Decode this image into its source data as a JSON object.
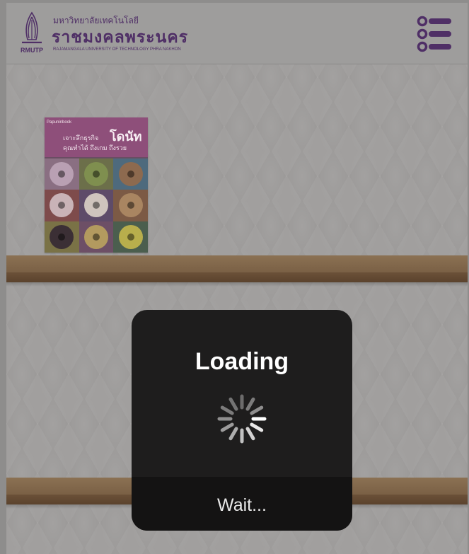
{
  "header": {
    "emblem_caption": "RMUTP",
    "university_name_thai_small": "มหาวิทยาลัยเทคโนโลยี",
    "university_name_thai": "ราชมงคลพระนคร",
    "university_name_english": "RAJAMANGALA UNIVERSITY OF TECHNOLOGY PHRA NAKHON",
    "brand_color": "#4f2f66",
    "menu_icon": "list-menu-icon"
  },
  "shelf": {
    "books": [
      {
        "publisher": "Papuninbook",
        "title_prefix": "เจาะลึกธุรกิจ",
        "title_main": "โดนัท",
        "subtitle": "คุณทำได้ ถึงเกม ถึงรวย",
        "cover_color": "#8e4f7a"
      }
    ],
    "wood_color": "#8b7153"
  },
  "loading_dialog": {
    "title": "Loading",
    "message": "Wait...",
    "spinner_icon": "spinner-icon"
  }
}
